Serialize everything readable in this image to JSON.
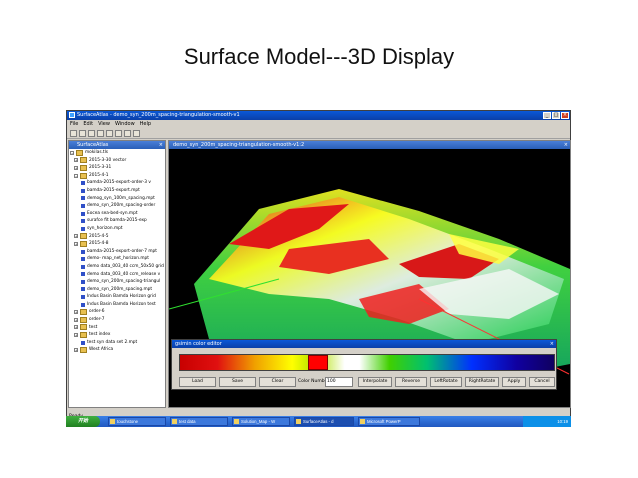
{
  "slide": {
    "title": "Surface Model---3D Display"
  },
  "window": {
    "title": "SurfaceAtlas - demo_syn_200m_spacing-triangulation-smooth-v1"
  },
  "menubar": {
    "items": [
      "File",
      "Edit",
      "View",
      "Window",
      "Help"
    ]
  },
  "tree_panel": {
    "title": "SurfaceAtlas",
    "rows": [
      {
        "label": "mokilas.tls",
        "kind": "root"
      },
      {
        "label": "2015-3-30 vector",
        "kind": "folder"
      },
      {
        "label": "2015-3-31",
        "kind": "folder"
      },
      {
        "label": "2015-4-1",
        "kind": "folder"
      },
      {
        "label": "bamda-2015-export-order-3 v",
        "kind": "doc"
      },
      {
        "label": "bamda-2015-export.mpt",
        "kind": "doc"
      },
      {
        "label": "demog_syn_100m_spacing.mpt",
        "kind": "doc"
      },
      {
        "label": "demo_syn_200m_spacing-order",
        "kind": "doc"
      },
      {
        "label": "Eocea sea-bed-syn.mpt",
        "kind": "doc"
      },
      {
        "label": "surafce fit bamda-2015-exp",
        "kind": "doc"
      },
      {
        "label": "syn_horizon.mpt",
        "kind": "doc"
      },
      {
        "label": "2015-4-5",
        "kind": "folder"
      },
      {
        "label": "2015-4-8",
        "kind": "folder"
      },
      {
        "label": "bamda-2015-export-order-7 mpt",
        "kind": "doc"
      },
      {
        "label": "demo- map_net_horizon.mpt",
        "kind": "doc"
      },
      {
        "label": "demo data_003_40 ccm_50x50 grid",
        "kind": "doc"
      },
      {
        "label": "demo data_003_40 ccm_release v",
        "kind": "doc"
      },
      {
        "label": "demo_syn_200m_spacing-triangul",
        "kind": "doc"
      },
      {
        "label": "demo_syn_200m_spacing.mpt",
        "kind": "doc"
      },
      {
        "label": "Indus Basin Bamda Horizon grid",
        "kind": "doc"
      },
      {
        "label": "Indus Basin Bamda Horizon test",
        "kind": "doc"
      },
      {
        "label": "order-6",
        "kind": "folder"
      },
      {
        "label": "order-7",
        "kind": "folder"
      },
      {
        "label": "test",
        "kind": "folder"
      },
      {
        "label": "test index",
        "kind": "folder"
      },
      {
        "label": "test syn data set 2.mpt",
        "kind": "doc"
      },
      {
        "label": "West Africa",
        "kind": "folder"
      }
    ]
  },
  "viewport": {
    "title": "demo_syn_200m_spacing-triangulation-smooth-v1:2"
  },
  "color_editor": {
    "title": "gsimin color editor",
    "buttons": {
      "load": "Load",
      "save": "Save",
      "clear": "Clear",
      "interpolate": "Interpolate",
      "reverse": "Reverse",
      "left_rotate": "LeftRotate",
      "right_rotate": "RightRotate",
      "apply": "Apply",
      "cancel": "Cancel"
    },
    "color_number_label": "Color Number",
    "color_number_value": "100",
    "selected_position": 0.37
  },
  "statusbar": {
    "text": "Ready"
  },
  "taskbar": {
    "start_label": "开始",
    "tasks": [
      "touchstone",
      "test data",
      "Solution_Map - W",
      "SurfaceAtlas - d",
      "Microsoft PowerP"
    ],
    "clock": "10:19"
  },
  "colors": {
    "titlebar": "#0a4fc0",
    "ramp_start": "#c80000",
    "ramp_end": "#100060",
    "marker": "#ff0000"
  }
}
